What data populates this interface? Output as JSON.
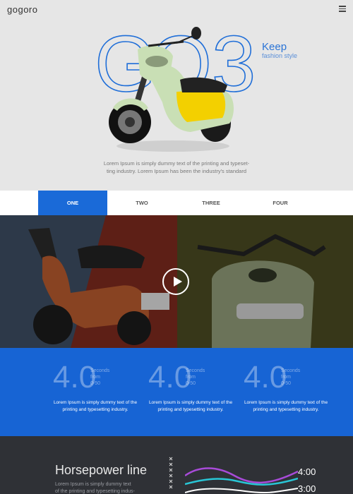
{
  "header": {
    "logo": "gogoro",
    "hero_title": "GO3",
    "hero_chars": [
      "G",
      "O",
      "3"
    ],
    "keep": "Keep",
    "fashion": "fashion style",
    "description_line1": "Lorem Ipsum is simply dummy text of the printing and typeset-",
    "description_line2": "ting industry. Lorem Ipsum has been the industry's standard"
  },
  "tabs": [
    {
      "label": "ONE",
      "active": true
    },
    {
      "label": "TWO",
      "active": false
    },
    {
      "label": "THREE",
      "active": false
    },
    {
      "label": "FOUR",
      "active": false
    }
  ],
  "stats": [
    {
      "value": "4.0",
      "label_lines": [
        "Seconds",
        "from",
        "0-50"
      ],
      "text_lines": [
        "Lorem Ipsum is simply dummy text of the",
        "printing and typesetting industry."
      ]
    },
    {
      "value": "4.0",
      "label_lines": [
        "Seconds",
        "from",
        "0-50"
      ],
      "text_lines": [
        "Lorem Ipsum is simply dummy text of the",
        "printing and typesetting industry."
      ]
    },
    {
      "value": "4.0",
      "label_lines": [
        "Seconds",
        "from",
        "0-50"
      ],
      "text_lines": [
        "Lorem Ipsum is simply dummy text of the",
        "printing and typesetting industry."
      ]
    }
  ],
  "horsepower": {
    "title": "Horsepower line",
    "desc_line1": "Lorem Ipsum is simply dummy text",
    "desc_line2": "of the printing and typesetting indus-",
    "reading_1": "4:00",
    "reading_2": "3:00"
  },
  "colors": {
    "accent": "#1a6ad8",
    "stats_bg": "#1764d4",
    "dark_bg": "#2f3136"
  }
}
